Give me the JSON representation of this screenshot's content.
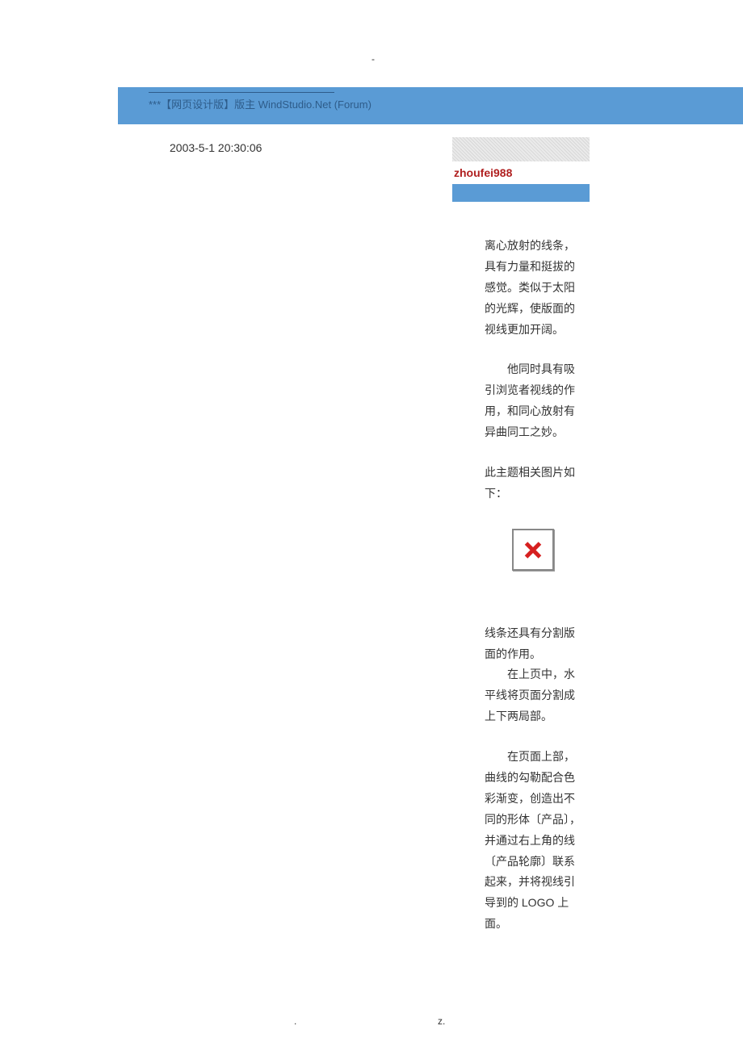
{
  "header": {
    "top_dash": "-",
    "bar_text": "***【网页设计版】版主  WindStudio.Net (Forum)",
    "timestamp": "2003-5-1 20:30:06",
    "username": "zhoufei988"
  },
  "content": {
    "p1": "离心放射的线条，具有力量和挺拔的感觉。类似于太阳的光辉，使版面的视线更加开阔。",
    "p2": "　　他同时具有吸引浏览者视线的作用，和同心放射有异曲同工之妙。",
    "p3": "此主题相关图片如下：",
    "p4a": "线条还具有分割版面的作用。",
    "p4b": "　　在上页中，水平线将页面分割成上下两局部。",
    "p5": "　　在页面上部，曲线的勾勒配合色彩渐变，创造出不同的形体〔产品〕，并通过右上角的线〔产品轮廓〕联系起来，并将视线引导到的 LOGO 上面。"
  },
  "footer": {
    "dot": ".",
    "z": "z."
  }
}
